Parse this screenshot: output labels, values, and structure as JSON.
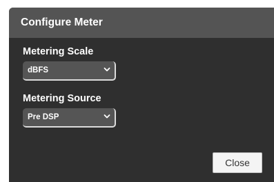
{
  "dialog": {
    "title": "Configure Meter",
    "close_label": "Close",
    "fields": [
      {
        "label": "Metering Scale",
        "selected": "dBFS"
      },
      {
        "label": "Metering Source",
        "selected": "Pre DSP"
      }
    ]
  },
  "colors": {
    "header_bg": "#545454",
    "body_bg": "#2f2f2f",
    "select_bg": "#555555",
    "text": "#ffffff",
    "button_bg": "#f4f4f4"
  },
  "icons": {
    "select_arrow": "chevron-down-icon"
  }
}
